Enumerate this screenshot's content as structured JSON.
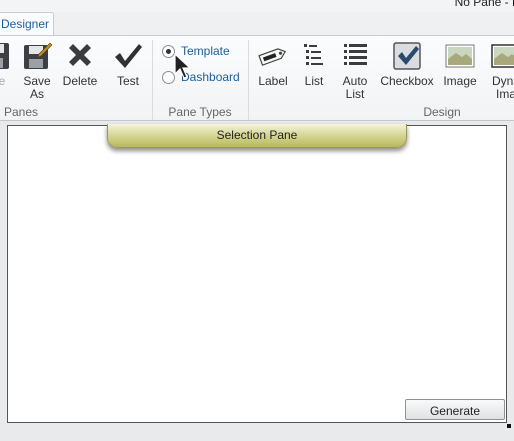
{
  "titlebar": {
    "right_text": "No Pane - P"
  },
  "tabs": [
    {
      "label": "Designer"
    }
  ],
  "ribbon": {
    "panes_group": {
      "label": "Panes",
      "buttons": [
        {
          "label": "ve",
          "icon": "save-icon"
        },
        {
          "label": "Save\nAs",
          "icon": "save-as-icon"
        },
        {
          "label": "Delete",
          "icon": "delete-x-icon"
        },
        {
          "label": "Test",
          "icon": "checkmark-icon"
        }
      ]
    },
    "pane_types_group": {
      "label": "Pane Types",
      "options": [
        {
          "label": "Template",
          "selected": true
        },
        {
          "label": "Dashboard",
          "selected": false
        }
      ]
    },
    "design_group": {
      "label": "Design",
      "buttons": [
        {
          "label": "Label",
          "icon": "label-tag-icon"
        },
        {
          "label": "List",
          "icon": "list-icon"
        },
        {
          "label": "Auto\nList",
          "icon": "auto-list-icon"
        },
        {
          "label": "Checkbox",
          "icon": "checkbox-icon"
        },
        {
          "label": "Image",
          "icon": "image-icon"
        },
        {
          "label": "Dyna\nIma",
          "icon": "dynamic-image-icon"
        }
      ]
    }
  },
  "canvas": {
    "selection_pane_title": "Selection Pane",
    "generate_label": "Generate"
  },
  "colors": {
    "accent_text": "#1d5e9c",
    "selection_pane": "#d8d89a"
  }
}
